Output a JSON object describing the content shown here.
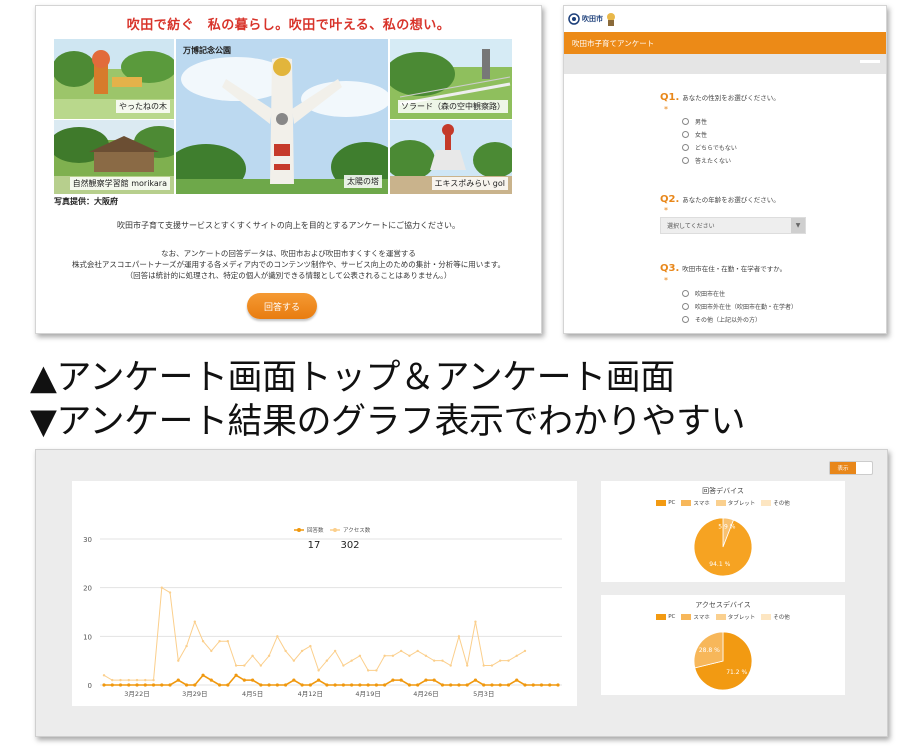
{
  "survey_top": {
    "headline": "吹田で紡ぐ　私の暮らし。吹田で叶える、私の想い。",
    "photos": [
      {
        "caption": "やったねの木"
      },
      {
        "caption": "万博記念公園"
      },
      {
        "caption": "ソラード（森の空中観察路）"
      },
      {
        "caption": "自然観察学習館 morikara"
      },
      {
        "caption": "太陽の塔"
      },
      {
        "caption": "エキスポみらい gol"
      }
    ],
    "photo_credit": "写真提供：大阪府",
    "intro": "吹田市子育て支援サービスとすくすくサイトの向上を目的とするアンケートにご協力ください。",
    "note": [
      "なお、アンケートの回答データは、吹田市および吹田市すくすくを運営する",
      "株式会社アスコエパートナーズが運用する各メディア内でのコンテンツ制作や、サービス向上のための集計・分析等に用います。",
      "（回答は統計的に処理され、特定の個人が識別できる情報として公表されることはありません。）"
    ],
    "answer_button": "回答する"
  },
  "survey_form": {
    "logo_text": "吹田市",
    "header_title": "吹田市子育てアンケート",
    "q1": {
      "number": "Q1.",
      "text": "あなたの性別をお選びください。",
      "options": [
        "男性",
        "女性",
        "どちらでもない",
        "答えたくない"
      ]
    },
    "q2": {
      "number": "Q2.",
      "text": "あなたの年齢をお選びください。",
      "select_placeholder": "選択してください"
    },
    "q3": {
      "number": "Q3.",
      "text": "吹田市在住・在勤・在学者ですか。",
      "options": [
        "吹田市在住",
        "吹田市外在住（吹田市在勤・在学者）",
        "その他（上記以外の方）"
      ]
    },
    "required_mark": "*"
  },
  "captions": {
    "line1": "▲アンケート画面トップ＆アンケート画面",
    "line2": "▼アンケート結果のグラフ表示でわかりやすい"
  },
  "results": {
    "toggle_label": "表示",
    "colors": {
      "answers": "#f0980e",
      "access": "#fbcf8c"
    }
  },
  "chart_data": [
    {
      "type": "line",
      "legend": [
        "回答数",
        "アクセス数"
      ],
      "totals": [
        "17",
        "302"
      ],
      "ylim": [
        0,
        30
      ],
      "yticks": [
        "0",
        "10",
        "20",
        "30"
      ],
      "xtick_labels": [
        "3月22日",
        "3月29日",
        "4月5日",
        "4月12日",
        "4月19日",
        "4月26日",
        "5月3日"
      ],
      "xtick_index": [
        4,
        11,
        18,
        25,
        32,
        39,
        46
      ],
      "series": [
        {
          "name": "回答数",
          "values": [
            0,
            0,
            0,
            0,
            0,
            0,
            0,
            0,
            0,
            1,
            0,
            0,
            2,
            1,
            0,
            0,
            2,
            1,
            1,
            0,
            0,
            0,
            0,
            1,
            0,
            0,
            1,
            0,
            0,
            0,
            0,
            0,
            0,
            0,
            0,
            1,
            1,
            0,
            0,
            1,
            1,
            0,
            0,
            0,
            0,
            1,
            0,
            0,
            0,
            0,
            1,
            0,
            0,
            0,
            0,
            0
          ]
        },
        {
          "name": "アクセス数",
          "values": [
            2,
            1,
            1,
            1,
            1,
            1,
            1,
            20,
            19,
            5,
            8,
            13,
            9,
            7,
            9,
            9,
            4,
            4,
            6,
            4,
            6,
            10,
            7,
            5,
            7,
            8,
            3,
            5,
            7,
            4,
            5,
            6,
            3,
            3,
            6,
            6,
            7,
            6,
            7,
            6,
            5,
            5,
            4,
            10,
            4,
            13,
            4,
            4,
            5,
            5,
            6,
            7
          ]
        }
      ]
    },
    {
      "type": "pie",
      "title": "回答デバイス",
      "legend": [
        "PC",
        "スマホ",
        "タブレット",
        "その他"
      ],
      "values": [
        5.9,
        94.1,
        0,
        0
      ],
      "labels": [
        "5.9 %",
        "94.1 %"
      ]
    },
    {
      "type": "pie",
      "title": "アクセスデバイス",
      "legend": [
        "PC",
        "スマホ",
        "タブレット",
        "その他"
      ],
      "values": [
        71.2,
        28.8,
        0,
        0
      ],
      "labels": [
        "71.2 %",
        "28.8 %"
      ]
    }
  ]
}
